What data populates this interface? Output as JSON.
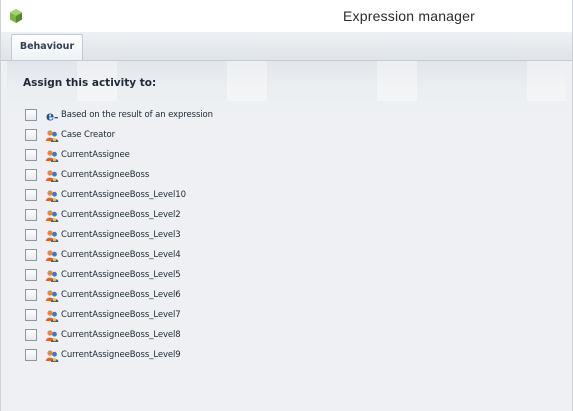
{
  "window": {
    "title": "Expression manager"
  },
  "tabs": [
    {
      "label": "Behaviour",
      "active": true
    }
  ],
  "section": {
    "title": "Assign this activity to:"
  },
  "options": [
    {
      "label": "Based on the result of an expression",
      "icon": "expression-icon",
      "checked": false
    },
    {
      "label": "Case Creator",
      "icon": "user-role-icon",
      "checked": false
    },
    {
      "label": "CurrentAssignee",
      "icon": "user-role-icon",
      "checked": false
    },
    {
      "label": "CurrentAssigneeBoss",
      "icon": "user-role-icon",
      "checked": false
    },
    {
      "label": "CurrentAssigneeBoss_Level10",
      "icon": "user-role-icon",
      "checked": false
    },
    {
      "label": "CurrentAssigneeBoss_Level2",
      "icon": "user-role-icon",
      "checked": false
    },
    {
      "label": "CurrentAssigneeBoss_Level3",
      "icon": "user-role-icon",
      "checked": false
    },
    {
      "label": "CurrentAssigneeBoss_Level4",
      "icon": "user-role-icon",
      "checked": false
    },
    {
      "label": "CurrentAssigneeBoss_Level5",
      "icon": "user-role-icon",
      "checked": false
    },
    {
      "label": "CurrentAssigneeBoss_Level6",
      "icon": "user-role-icon",
      "checked": false
    },
    {
      "label": "CurrentAssigneeBoss_Level7",
      "icon": "user-role-icon",
      "checked": false
    },
    {
      "label": "CurrentAssigneeBoss_Level8",
      "icon": "user-role-icon",
      "checked": false
    },
    {
      "label": "CurrentAssigneeBoss_Level9",
      "icon": "user-role-icon",
      "checked": false
    }
  ],
  "colors": {
    "accent": "#7cb342",
    "role_icon_orange": "#e8873a",
    "role_icon_blue": "#3a78c8"
  }
}
